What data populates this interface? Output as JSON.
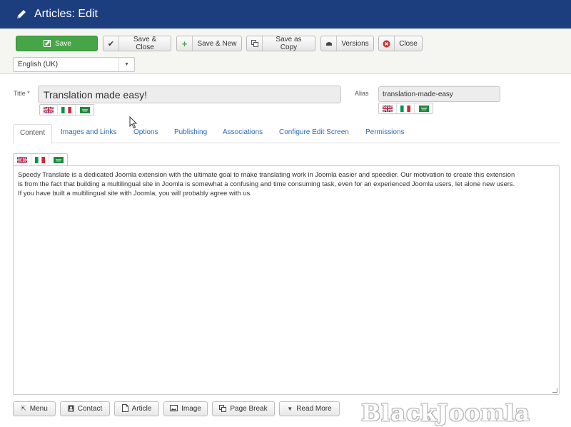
{
  "header": {
    "title": "Articles: Edit",
    "icon": "pencil-icon"
  },
  "toolbar": {
    "save": "Save",
    "save_close": "Save & Close",
    "save_new": "Save & New",
    "save_copy": "Save as Copy",
    "versions": "Versions",
    "close": "Close"
  },
  "language_select": {
    "value": "English (UK)"
  },
  "form": {
    "title_label": "Title *",
    "title_value": "Translation made easy!",
    "alias_label": "Alias",
    "alias_value": "translation-made-easy"
  },
  "flags": [
    "uk-flag",
    "italy-flag",
    "arabic-flag"
  ],
  "tabs": [
    "Content",
    "Images and Links",
    "Options",
    "Publishing",
    "Associations",
    "Configure Edit Screen",
    "Permissions"
  ],
  "editor": {
    "lines": [
      "Speedy Translate is a dedicated Joomla extension with the ultimate goal to make translating work in Joomla easier and speedier. Our motivation to create this extension",
      "is from the fact that building a multilingual site in Joomla is somewhat a confusing and time consuming task, even for an experienced Joomla users, let alone new users.",
      "If you have built a multilingual site with Joomla, you will probably agree with us."
    ]
  },
  "editor_buttons": [
    "Menu",
    "Contact",
    "Article",
    "Image",
    "Page Break",
    "Read More"
  ],
  "watermark": "BlackJoomla",
  "colors": {
    "header_bg": "#1c3d7e",
    "save_green": "#46a546",
    "link_blue": "#2a69b8"
  }
}
